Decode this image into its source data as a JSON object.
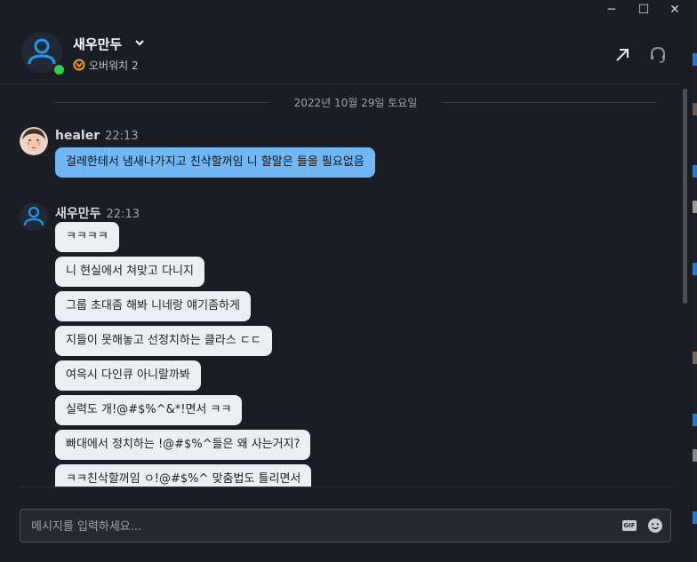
{
  "window": {
    "minimize_glyph": "─",
    "maximize_glyph": "☐",
    "close_glyph": "✕"
  },
  "header": {
    "contact_name": "새우만두",
    "game_name": "오버워치 2",
    "status_color": "#2bd14b",
    "game_icon_color": "#f99e1a",
    "icons": [
      "dropdown-chevron-icon",
      "pop-out-arrow-icon",
      "headset-icon"
    ]
  },
  "date_separator": "2022년 10월 29일 토요일",
  "messages": [
    {
      "author": "healer",
      "time": "22:13",
      "side": "sent",
      "bubbles": [
        "걸레한테서 냄새나가지고 친삭할꺼임 니 할말은 들을 필요없음"
      ]
    },
    {
      "author": "새우만두",
      "time": "22:13",
      "side": "received",
      "bubbles": [
        "ㅋㅋㅋㅋ",
        "니 현실에서 쳐맞고 다니지",
        "그룹 초대좀 해봐 니네랑 얘기좀하게",
        "지들이 못해놓고 선정치하는 클라스 ㄷㄷ",
        "여윽시 다인큐 아니랄까봐",
        "실력도 개!@#$%^&*!면서 ㅋㅋ",
        "빠대에서 정치하는 !@#$%^들은 왜 사는거지?",
        "ㅋㅋ친삭할꺼임 ㅇ!@#$%^ 맞춤법도 틀리면서"
      ]
    }
  ],
  "composer": {
    "placeholder": "메시지를 입력하세요...",
    "value": "",
    "gif_label": "GIF",
    "icons": [
      "gif-icon",
      "emoji-icon"
    ]
  },
  "colors": {
    "background": "#1b1d25",
    "sent_bubble": "#71b7f2",
    "received_bubble": "#eceef2"
  }
}
